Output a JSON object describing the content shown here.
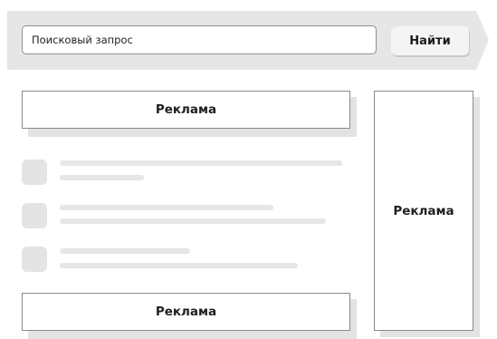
{
  "search": {
    "query": "Поисковый запрос",
    "button_label": "Найти"
  },
  "ads": {
    "top_label": "Реклама",
    "side_label": "Реклама",
    "bottom_label": "Реклама"
  },
  "results": {
    "count": 3,
    "style": "placeholder-skeleton"
  },
  "colors": {
    "page_background": "#ffffff",
    "search_bar_background": "#e6e6e6",
    "placeholder_gray": "#e4e4e4",
    "border_gray": "#8a8a8a"
  }
}
